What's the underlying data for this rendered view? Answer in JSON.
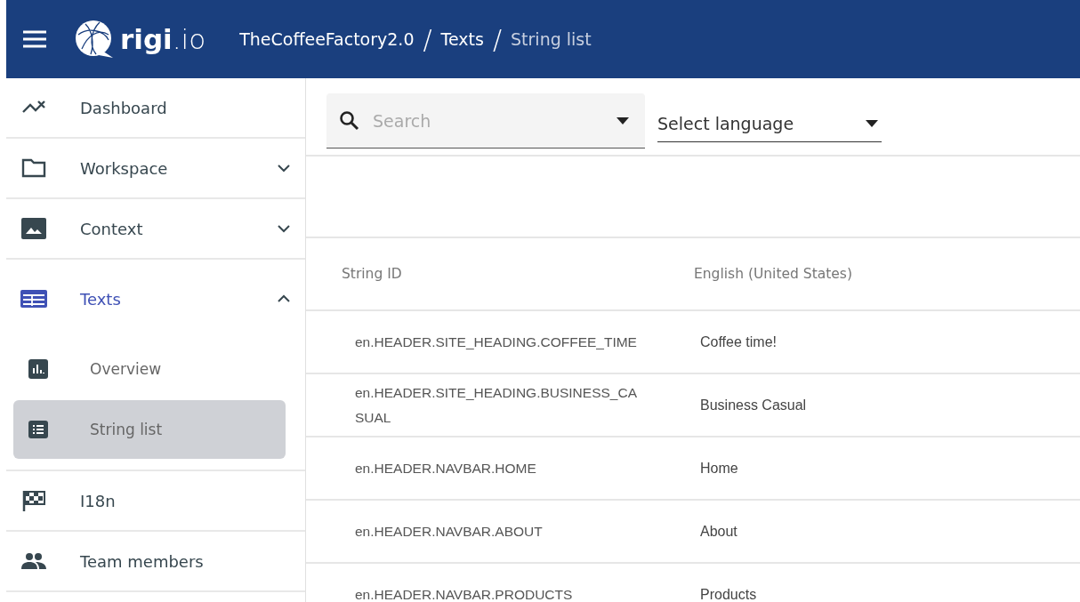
{
  "header": {
    "logo": "**rigi**.io",
    "breadcrumbs": [
      {
        "label": "TheCoffeeFactory2.0",
        "current": false
      },
      {
        "separator": "/",
        "label": "Texts",
        "current": false
      },
      {
        "separator": "/",
        "label": "String list",
        "current": true
      }
    ]
  },
  "sidebar": {
    "items": [
      {
        "label": "Dashboard",
        "selected": false
      },
      {
        "label": "Workspace",
        "selected": false,
        "expanded": false
      },
      {
        "label": "Context",
        "selected": false,
        "expanded": false
      },
      {
        "label": "Texts",
        "selected": true,
        "expanded": true,
        "children": [
          {
            "label": "Overview",
            "selected": false
          },
          {
            "label": "String list",
            "selected": true
          }
        ]
      },
      {
        "label": "I18n",
        "selected": false
      },
      {
        "label": "Team members",
        "selected": false
      }
    ]
  },
  "filters": {
    "search": {
      "placeholder": "Search"
    },
    "language": {
      "value": "Select language"
    }
  },
  "table": {
    "columns": [
      "String ID",
      "English (United States)"
    ],
    "rows": [
      [
        "en.HEADER.SITE_HEADING.COFFEE_TIME",
        "Coffee time!"
      ],
      [
        "en.HEADER.SITE_HEADING.BUSINESS_CASUAL",
        "Business Casual"
      ],
      [
        "en.HEADER.NAVBAR.HOME",
        "Home"
      ],
      [
        "en.HEADER.NAVBAR.ABOUT",
        "About"
      ],
      [
        "en.HEADER.NAVBAR.PRODUCTS",
        "Products"
      ]
    ]
  }
}
